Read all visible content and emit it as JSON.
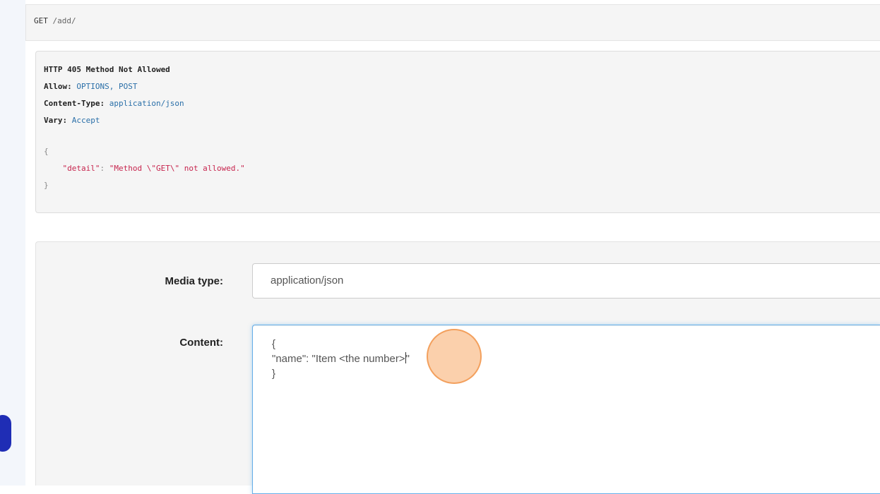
{
  "request": {
    "method": "GET",
    "path": "/add/"
  },
  "response": {
    "status_line": "HTTP 405 Method Not Allowed",
    "headers": [
      {
        "name": "Allow:",
        "value": "OPTIONS, POST"
      },
      {
        "name": "Content-Type:",
        "value": "application/json"
      },
      {
        "name": "Vary:",
        "value": "Accept"
      }
    ],
    "body": {
      "open_brace": "{",
      "key": "\"detail\"",
      "colon": ": ",
      "value": "\"Method \\\"GET\\\" not allowed.\"",
      "close_brace": "}"
    }
  },
  "form": {
    "media_type_label": "Media type:",
    "media_type_value": "application/json",
    "content_label": "Content:",
    "content_lines": {
      "line1": "{",
      "line2_before_caret": "\"name\": \"Item <the number>",
      "line2_after_caret": "\"",
      "line3": "}"
    }
  },
  "colors": {
    "accent_focus": "#66afe9",
    "json_string": "#c7254e",
    "header_value": "#2a6fa8",
    "cursor_highlight": "#f69646"
  }
}
